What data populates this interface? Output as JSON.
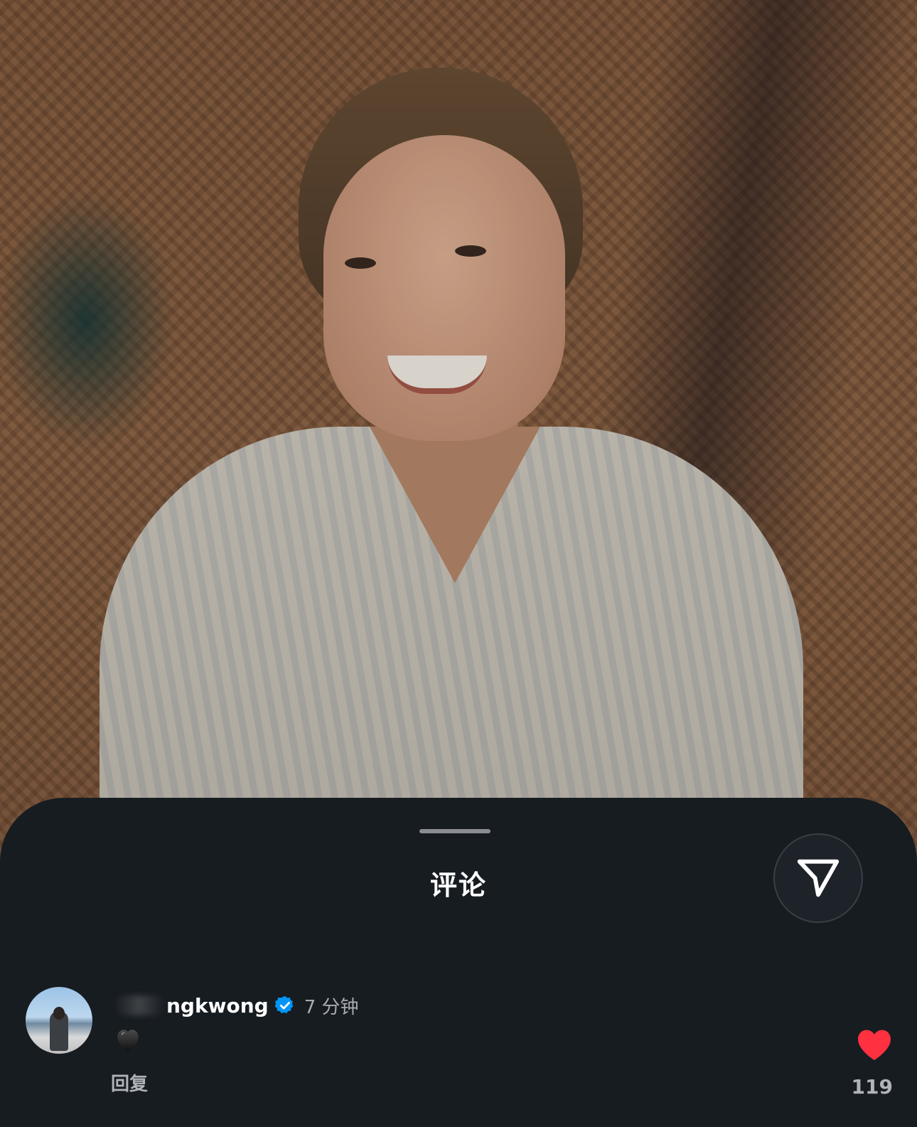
{
  "sheet": {
    "title": "评论"
  },
  "share_button": {
    "icon": "send-icon"
  },
  "comment": {
    "username_visible": "ngkwong",
    "verified": true,
    "time": "7 分钟",
    "body_emoji": "black-heart-icon",
    "reply_label": "回复",
    "like_count": "119",
    "liked": true,
    "like_color": "#ff3040",
    "verified_color": "#0095f6"
  },
  "colors": {
    "sheet_bg": "#171c21",
    "text_primary": "#ffffff",
    "text_secondary": "#a8acb1"
  }
}
